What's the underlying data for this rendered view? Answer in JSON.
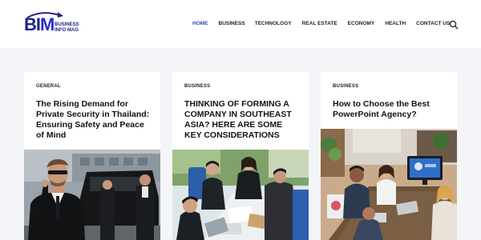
{
  "logo": {
    "main": "BIM",
    "line1": "BUSINESS",
    "line2": "INFO MAG"
  },
  "nav": [
    "HOME",
    "BUSINESS",
    "TECHNOLOGY",
    "REAL ESTATE",
    "ECONOMY",
    "HEALTH",
    "CONTACT US"
  ],
  "nav_active": "HOME",
  "icons": {
    "search": "search-icon"
  },
  "colors": {
    "brand": "#23238a",
    "active_nav": "#2a4fbf",
    "background": "#f3f5f8"
  },
  "cards": [
    {
      "category": "GENERAL",
      "title": "The Rising Demand for Private Security in Thailand: Ensuring Safety and Peace of Mind",
      "image": "security-guard-photo"
    },
    {
      "category": "BUSINESS",
      "title": "THINKING OF FORMING A COMPANY IN SOUTHEAST ASIA? HERE ARE SOME KEY CONSIDERATIONS",
      "image": "business-meeting-photo"
    },
    {
      "category": "BUSINESS",
      "title": "How to Choose the Best PowerPoint Agency?",
      "image": "office-presentation-photo"
    }
  ]
}
